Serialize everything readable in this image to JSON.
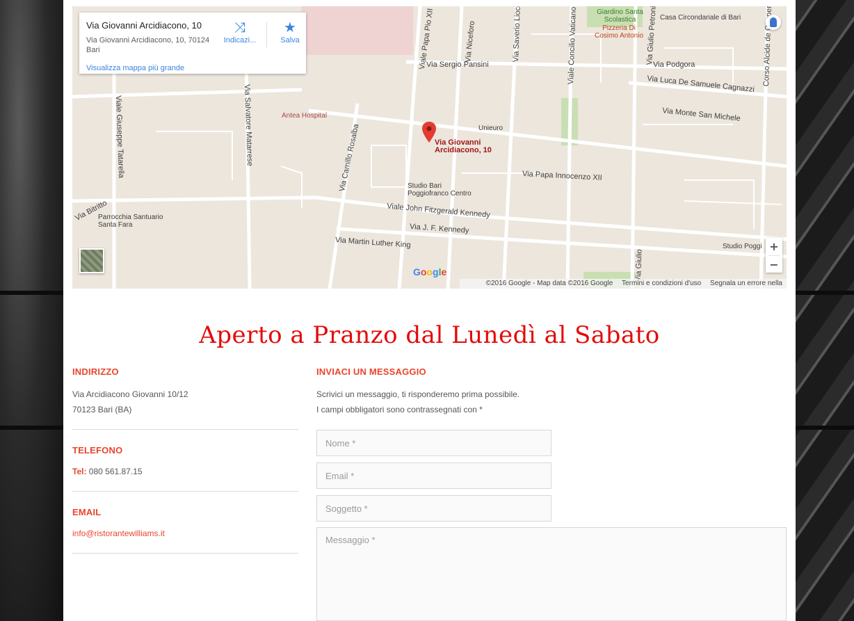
{
  "map": {
    "info_card": {
      "title": "Via Giovanni Arcidiacono, 10",
      "address": "Via Giovanni Arcidiacono, 10, 70124 Bari",
      "directions_label": "Indicazi...",
      "save_label": "Salva",
      "larger_map_link": "Visualizza mappa più grande",
      "directions_icon": "directions-icon",
      "save_icon": "star-icon"
    },
    "pin_label": "Via Giovanni Arcidiacono, 10",
    "street_labels": [
      "Via Sergio Pansini",
      "Viale Papa Pio XII",
      "Via Niceforo",
      "Via Saverio Lioce",
      "Viale Concilio Vaticano",
      "Giardino Santa Scolastica",
      "Pizzeria Di Cosimo Antonio",
      "Via Giulio Petroni",
      "Casa Circondariale di Bari",
      "Via Podgora",
      "Via Luca De Samuele Cagnazzi",
      "Via Monte San Michele",
      "Corso Alcide de Gasperi",
      "Antea Hospital",
      "Unieuro",
      "Via Camillo Rosalba",
      "Via Salvatore Matarrese",
      "Viale Giuseppe Tatarella",
      "Via Papa Innocenzo XII",
      "Studio Bari Poggiofranco Centro",
      "Viale John Fitzgerald Kennedy",
      "Via J. F. Kennedy",
      "Via Martin Luther King",
      "Via Bitritto",
      "Parrocchia Santuario Santa Fara",
      "Studio Poggi",
      "Via Giulio"
    ],
    "zoom_in": "+",
    "zoom_out": "−",
    "google_logo": [
      "G",
      "o",
      "o",
      "g",
      "l",
      "e"
    ],
    "footer": {
      "copyright": "©2016 Google - Map data ©2016 Google",
      "terms": "Termini e condizioni d'uso",
      "report": "Segnala un errore nella mappa"
    }
  },
  "heading": "Aperto a Pranzo dal Lunedì al Sabato",
  "contact": {
    "address_title": "INDIRIZZO",
    "address_line1": "Via Arcidiacono Giovanni 10/12",
    "address_line2": "70123 Bari (BA)",
    "phone_title": "TELEFONO",
    "phone_label": "Tel:",
    "phone_value": "080 561.87.15",
    "email_title": "EMAIL",
    "email_value": "info@ristorantewilliams.it"
  },
  "form": {
    "title": "INVIACI UN MESSAGGIO",
    "intro_line1": "Scrivici un messaggio, ti risponderemo prima possibile.",
    "intro_line2": "I campi obbligatori sono contrassegnati con *",
    "name_placeholder": "Nome *",
    "email_placeholder": "Email *",
    "subject_placeholder": "Soggetto *",
    "message_placeholder": "Messaggio *"
  },
  "colors": {
    "accent": "#e8452c",
    "heading": "#e30a0a",
    "link": "#3a84df"
  }
}
